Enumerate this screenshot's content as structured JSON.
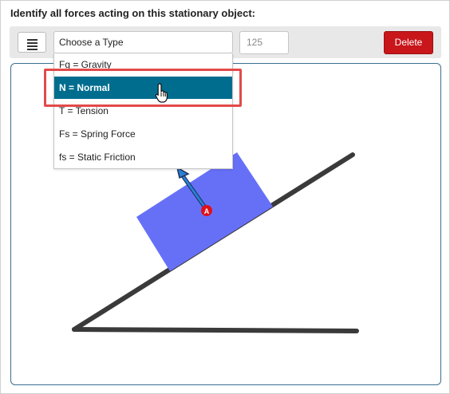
{
  "prompt": "Identify all forces acting on this stationary object:",
  "toolbar": {
    "menu_icon": "hamburger-menu-icon",
    "type_select": "Choose a Type",
    "value": "125",
    "delete_label": "Delete"
  },
  "dropdown": {
    "options": [
      "Fg = Gravity",
      "N = Normal",
      "T = Tension",
      "Fs = Spring Force",
      "fs = Static Friction"
    ],
    "selected_index": 1
  },
  "diagram": {
    "force_point_label": "A",
    "block_color": "#6670f7",
    "arrow_color": "#2a7fd4",
    "marker_color": "#e0101a"
  }
}
